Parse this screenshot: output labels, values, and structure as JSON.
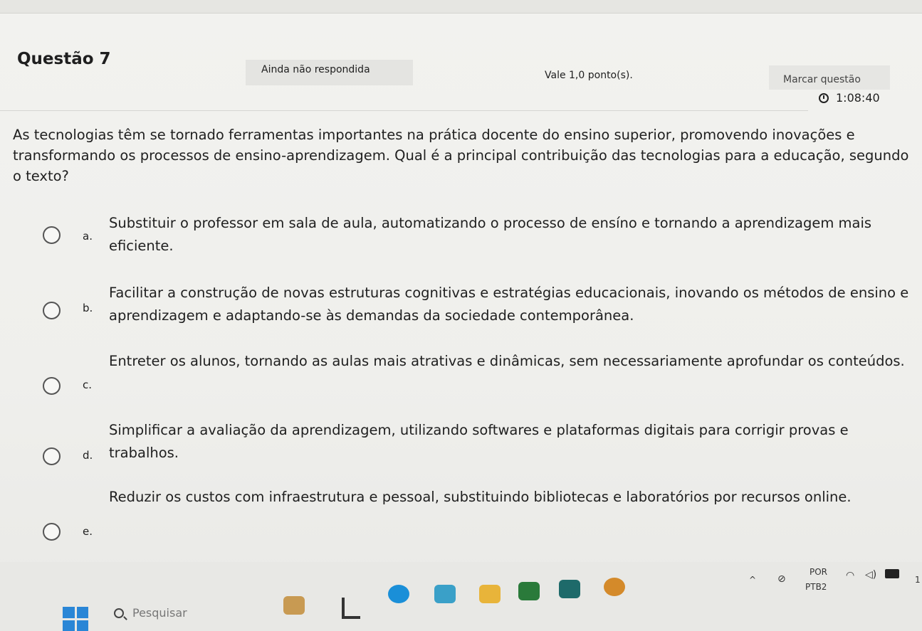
{
  "question": {
    "title": "Questão 7",
    "state": "Ainda não respondida",
    "grade": "Vale 1,0 ponto(s).",
    "flag_label": "Marcar questão",
    "timer": "1:08:40",
    "text": "As tecnologias têm se tornado ferramentas importantes na prática docente do ensino superior, promovendo inovações e transformando os processos de ensino-aprendizagem. Qual é a principal contribuição das tecnologias para a educação, segundo o texto?"
  },
  "options": [
    {
      "letter": "a.",
      "text": "Substituir o professor em sala de aula, automatizando o processo de ensíno e tornando a aprendizagem mais eficiente."
    },
    {
      "letter": "b.",
      "text": "Facilitar a construção de novas estruturas cognitivas e estratégias educacionais, inovando os métodos de ensino e aprendizagem e adaptando-se às demandas da sociedade contemporânea."
    },
    {
      "letter": "c.",
      "text": "Entreter os alunos, tornando as aulas mais atrativas e dinâmicas, sem necessariamente aprofundar os conteúdos."
    },
    {
      "letter": "d.",
      "text": "Simplificar a avaliação da aprendizagem, utilizando softwares e plataformas digitais para corrigir provas e trabalhos."
    },
    {
      "letter": "e.",
      "text": "Reduzir os custos com infraestrutura e pessoal, substituindo bibliotecas e laboratórios por recursos online."
    }
  ],
  "taskbar": {
    "search_placeholder": "Pesquisar",
    "language": "POR",
    "keyboard": "PTB2",
    "clock_partial": "1"
  },
  "icons": [
    "windows-icon",
    "search-icon",
    "chevron-up-icon",
    "network-icon",
    "wifi-icon",
    "volume-icon",
    "battery-icon",
    "clock-icon"
  ],
  "colors": {
    "accent": "#2a86d6",
    "edge": "#1a8fd8"
  }
}
